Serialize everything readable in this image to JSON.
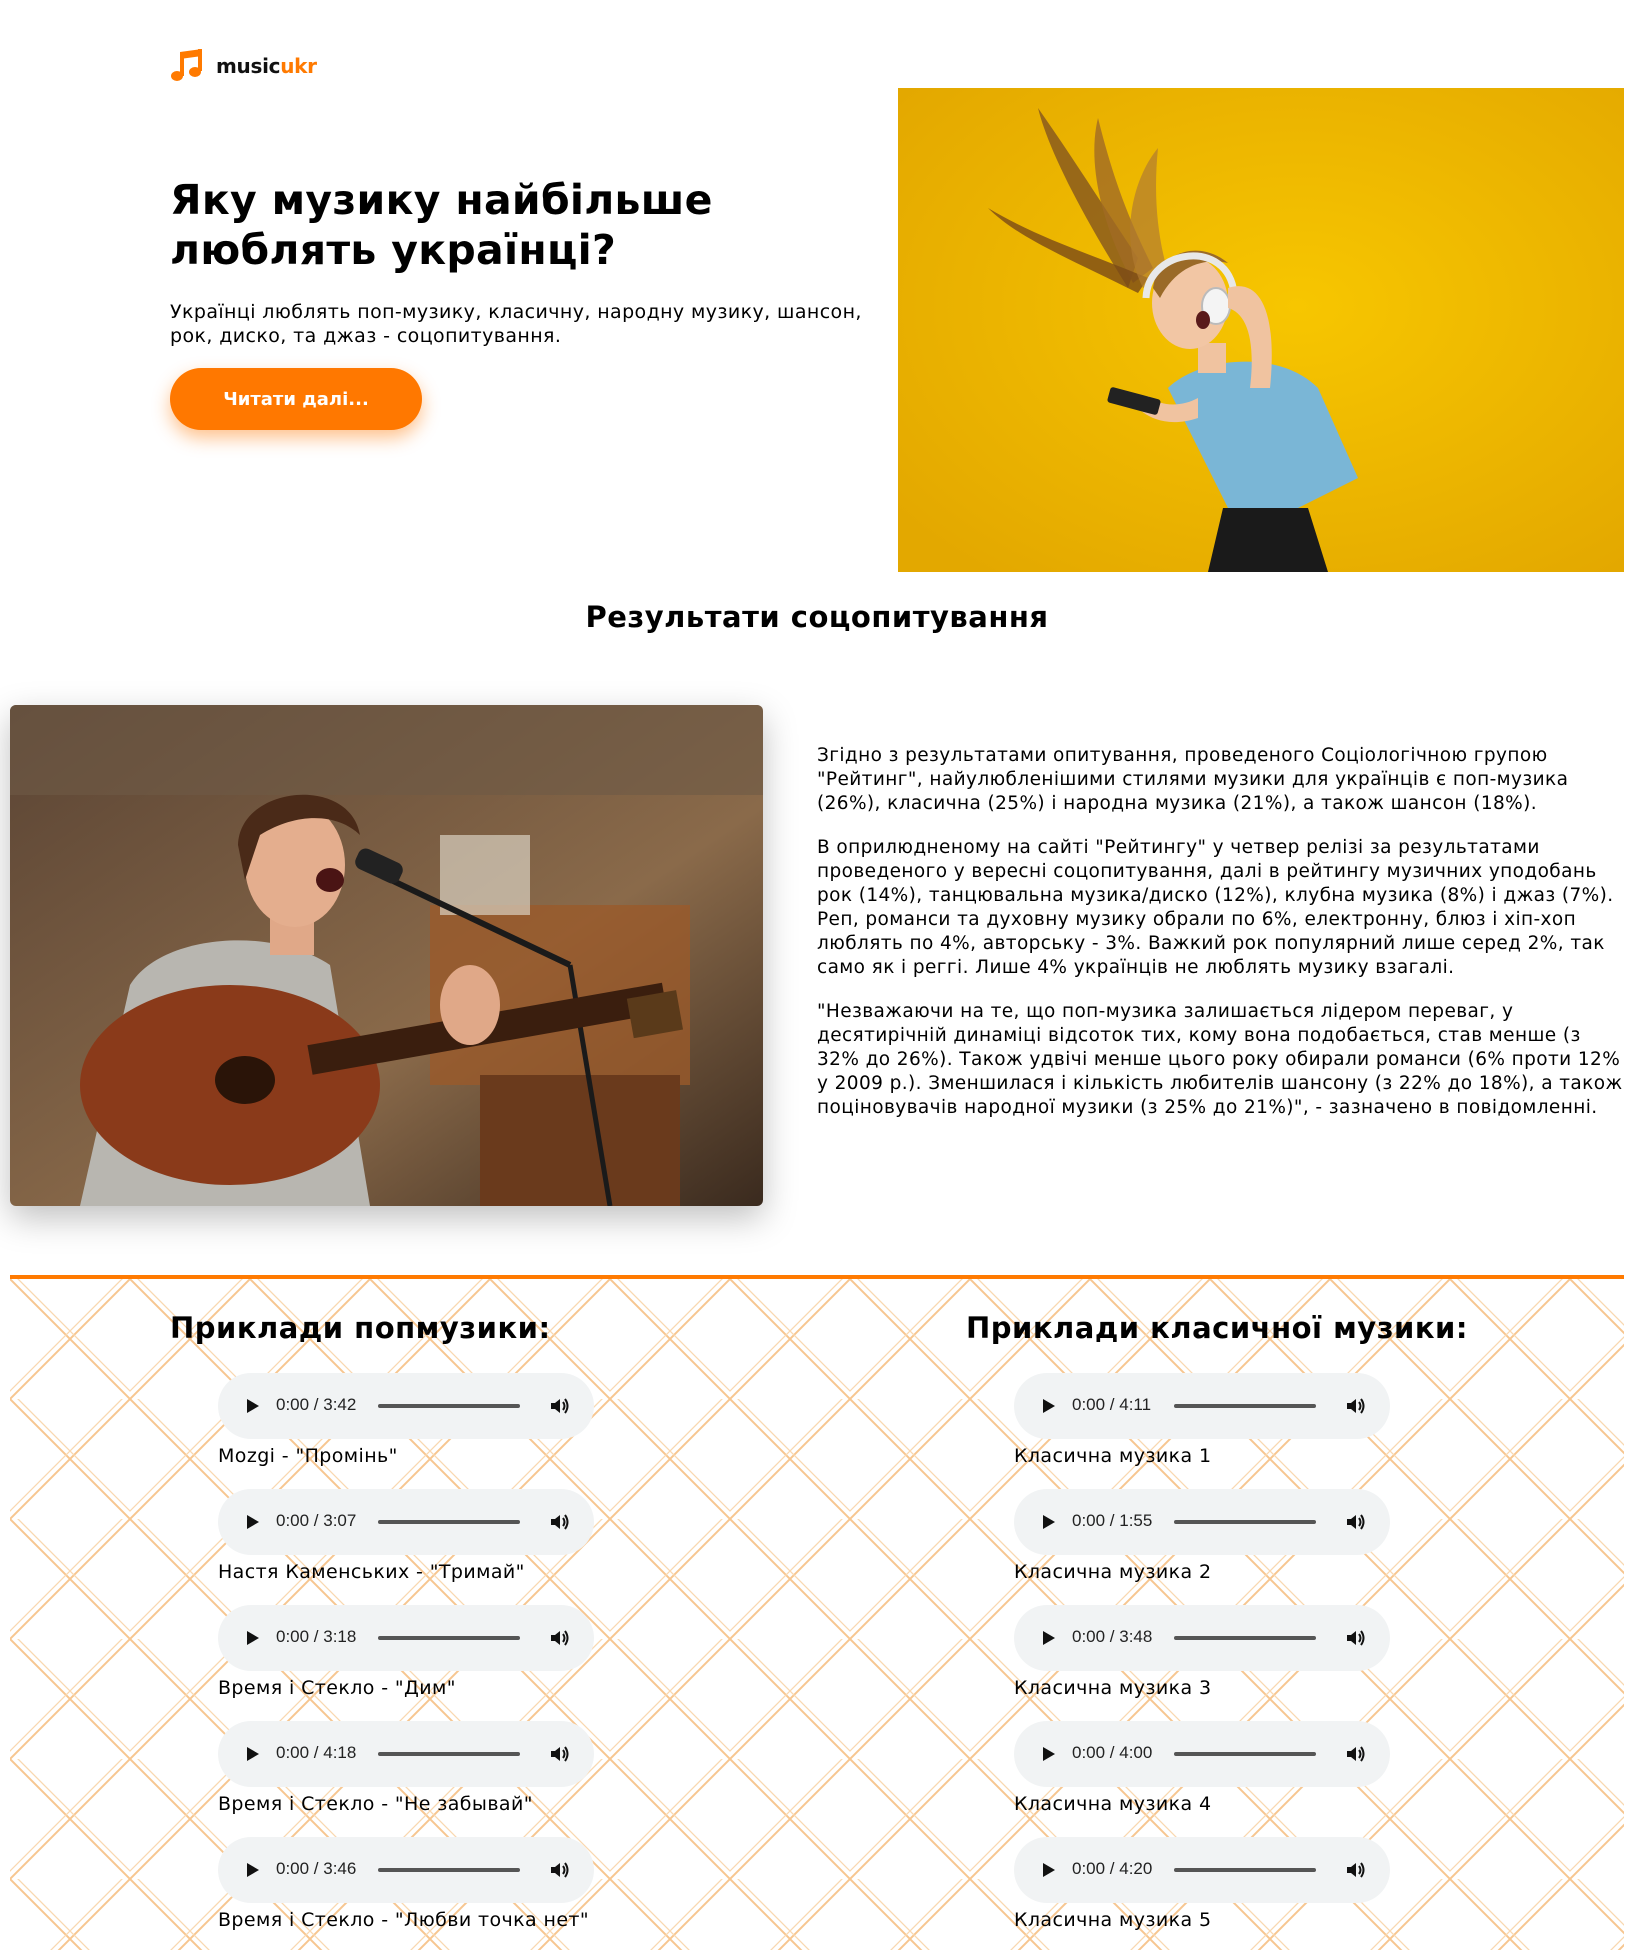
{
  "brand": {
    "part1": "music",
    "part2": "ukr",
    "icon": "music-note-icon",
    "accent": "#ff7a00"
  },
  "hero": {
    "title": "Яку музику найбільше люблять українці?",
    "text": "Українці люблять поп-музику, класичну, народну музику, шансон, рок, диско, та джаз - соцопитування.",
    "button": "Читати далі...",
    "image": "woman-with-headphones-photo"
  },
  "survey": {
    "title": "Результати соцопитування",
    "image": "guitar-singer-photo",
    "paragraphs": [
      "Згідно з результатами опитування, проведеного Соціологічною групою \"Рейтинг\", найулюбленішими стилями музики для українців є поп-музика (26%), класична (25%) і народна музика (21%), а також шансон (18%).",
      "В оприлюдненому на сайті \"Рейтингу\" у четвер релізі за результатами проведеного у вересні соцопитування, далі в рейтингу музичних уподобань рок (14%), танцювальна музика/диско (12%), клубна музика (8%) і джаз (7%). Реп, романси та духовну музику обрали по 6%, електронну, блюз і хіп-хоп люблять по 4%, авторську - 3%. Важкий рок популярний лише серед 2%, так само як і реггі. Лише 4% українців не люблять музику взагалі.",
      "\"Незважаючи на те, що поп-музика залишається лідером переваг, у десятирічній динаміці відсоток тих, кому вона подобається, став менше (з 32% до 26%). Також удвічі менше цього року обирали романси (6% проти 12% у 2009 р.). Зменшилася і кількість любителів шансону (з 22% до 18%), а також поціновувачів народної музики (з 25% до 21%)\", - зазначено в повідомленні."
    ]
  },
  "pop": {
    "title": "Приклади попмузики:",
    "tracks": [
      {
        "time": "0:00 / 3:42",
        "label": "Mozgi - \"Промінь\""
      },
      {
        "time": "0:00 / 3:07",
        "label": "Настя Каменських - \"Тримай\""
      },
      {
        "time": "0:00 / 3:18",
        "label": "Время і Стекло - \"Дим\""
      },
      {
        "time": "0:00 / 4:18",
        "label": "Время і Стекло - \"Не забывай\""
      },
      {
        "time": "0:00 / 3:46",
        "label": "Время і Стекло - \"Любви точка нет\""
      }
    ]
  },
  "classic": {
    "title": "Приклади класичної музики:",
    "tracks": [
      {
        "time": "0:00 / 4:11",
        "label": "Класична музика 1"
      },
      {
        "time": "0:00 / 1:55",
        "label": "Класична музика 2"
      },
      {
        "time": "0:00 / 3:48",
        "label": "Класична музика 3"
      },
      {
        "time": "0:00 / 4:00",
        "label": "Класична музика 4"
      },
      {
        "time": "0:00 / 4:20",
        "label": "Класична музика 5"
      }
    ]
  }
}
